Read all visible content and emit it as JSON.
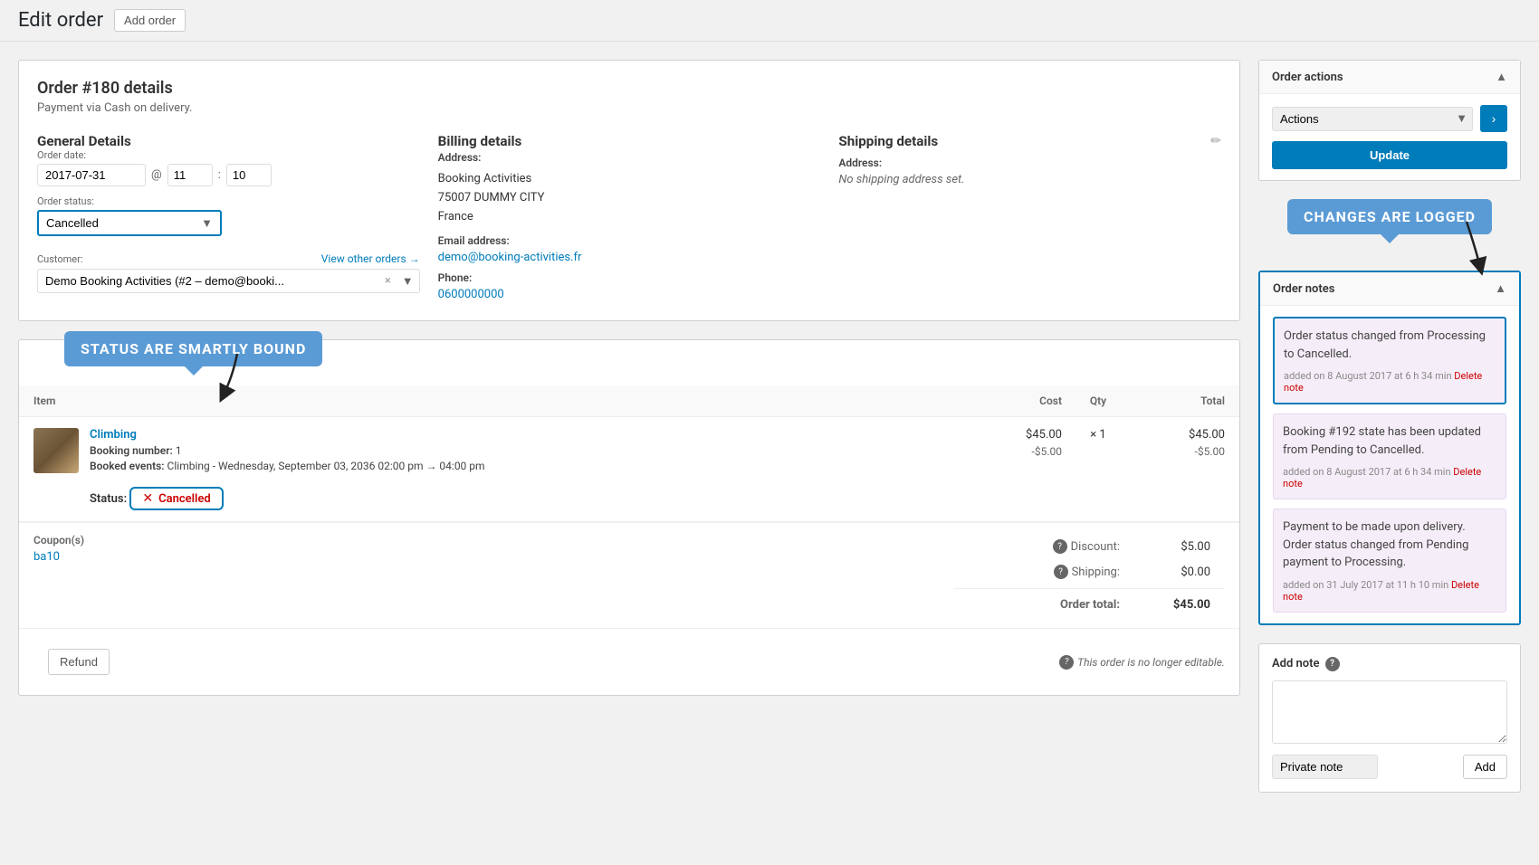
{
  "page": {
    "title": "Edit order",
    "add_order_btn": "Add order"
  },
  "order": {
    "number": "Order #180 details",
    "payment_method": "Payment via Cash on delivery.",
    "general": {
      "label": "General Details",
      "order_date_label": "Order date:",
      "order_date": "2017-07-31",
      "order_time_h": "11",
      "order_time_m": "10",
      "order_status_label": "Order status:",
      "order_status": "Cancelled",
      "customer_label": "Customer:",
      "view_other_orders": "View other orders →",
      "customer_value": "Demo Booking Activities (#2 – demo@booki... ×"
    },
    "billing": {
      "label": "Billing details",
      "address_label": "Address:",
      "address_line1": "Booking Activities",
      "address_line2": "75007 DUMMY CITY",
      "address_line3": "France",
      "email_label": "Email address:",
      "email": "demo@booking-activities.fr",
      "phone_label": "Phone:",
      "phone": "0600000000"
    },
    "shipping": {
      "label": "Shipping details",
      "address_label": "Address:",
      "address_value": "No shipping address set."
    }
  },
  "items": {
    "header": {
      "item": "Item",
      "cost": "Cost",
      "qty": "Qty",
      "total": "Total"
    },
    "rows": [
      {
        "name": "Climbing",
        "booking_number_label": "Booking number:",
        "booking_number": "1",
        "booked_events_label": "Booked events:",
        "booked_events": "Climbing - Wednesday, September 03, 2036 02:00 pm → 04:00 pm",
        "status_label": "Status:",
        "status_icon": "✕",
        "status": "Cancelled",
        "cost": "$45.00",
        "cost_discount": "-$5.00",
        "qty": "× 1",
        "total": "$45.00",
        "total_discount": "-$5.00"
      }
    ]
  },
  "totals": {
    "coupon_label": "Coupon(s)",
    "coupon_code": "ba10",
    "discount_label": "Discount:",
    "discount_value": "$5.00",
    "shipping_label": "Shipping:",
    "shipping_value": "$0.00",
    "order_total_label": "Order total:",
    "order_total_value": "$45.00",
    "refund_btn": "Refund",
    "not_editable": "This order is no longer editable."
  },
  "order_actions": {
    "title": "Order actions",
    "actions_label": "Actions",
    "update_btn": "Update",
    "arrow_btn": "›"
  },
  "order_notes": {
    "title": "Order notes",
    "notes": [
      {
        "text": "Order status changed from Processing to Cancelled.",
        "meta": "added on 8 August 2017 at 6 h 34 min",
        "delete": "Delete note",
        "highlighted": true
      },
      {
        "text": "Booking #192 state has been updated from Pending to Cancelled.",
        "meta": "added on 8 August 2017 at 6 h 34 min",
        "delete": "Delete note",
        "highlighted": false
      },
      {
        "text": "Payment to be made upon delivery. Order status changed from Pending payment to Processing.",
        "meta": "added on 31 July 2017 at 11 h 10 min",
        "delete": "Delete note",
        "highlighted": false
      }
    ]
  },
  "add_note": {
    "title": "Add note",
    "textarea_placeholder": "",
    "note_type": "Private note",
    "add_btn": "Add",
    "help_icon": "?"
  },
  "callouts": {
    "status_bound": "Status are smartly bound",
    "changes_logged": "Changes are logged"
  }
}
